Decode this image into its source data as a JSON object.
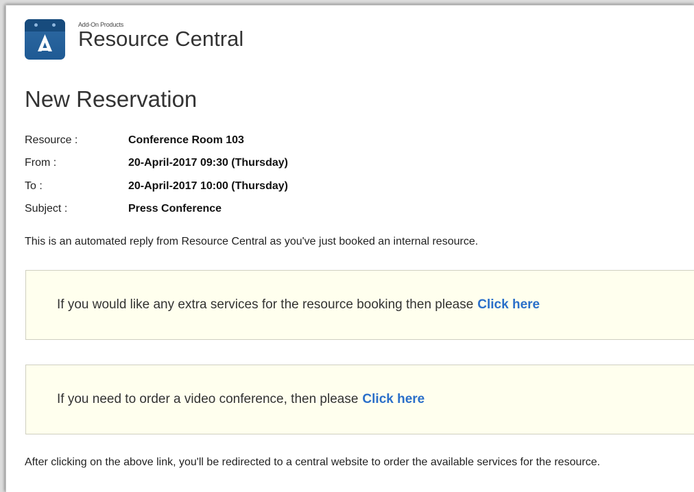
{
  "header": {
    "brand_subtitle": "Add-On Products",
    "brand_title": "Resource Central",
    "logo_icon": "calendar-a-icon"
  },
  "page_title": "New Reservation",
  "details": [
    {
      "label": "Resource :",
      "value": "Conference Room 103"
    },
    {
      "label": "From :",
      "value": "20-April-2017 09:30 (Thursday)"
    },
    {
      "label": "To :",
      "value": "20-April-2017 10:00 (Thursday)"
    },
    {
      "label": "Subject :",
      "value": "Press Conference"
    }
  ],
  "intro_text": "This is an automated reply from Resource Central as you've just booked an internal resource.",
  "notices": [
    {
      "text": "If you would like any extra services for the resource booking then please",
      "link": "Click here"
    },
    {
      "text": "If you need to order a video conference, then please",
      "link": "Click here"
    }
  ],
  "footer_text": "After clicking on the above link, you'll be redirected to a central website to order the available services for the resource.",
  "colors": {
    "link": "#2a6fc9",
    "notice_bg": "#ffffee",
    "logo_blue": "#1f5a94"
  }
}
